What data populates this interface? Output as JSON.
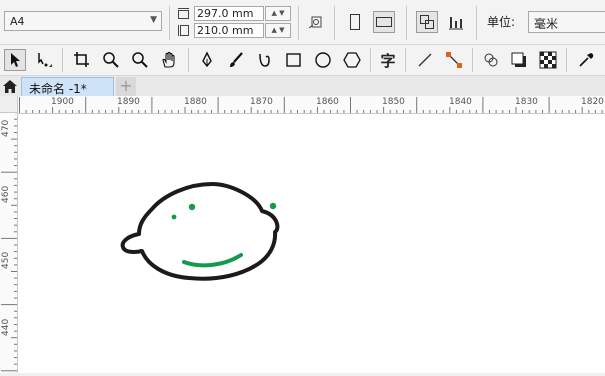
{
  "property_bar": {
    "page_size": "A4",
    "width_value": "297.0 mm",
    "height_value": "210.0 mm",
    "unit_label": "单位:",
    "unit_value": "毫米"
  },
  "tabs": {
    "document_title": "未命名 -1*",
    "add_tab": "+"
  },
  "ruler": {
    "horizontal_labels": [
      "1900",
      "1890",
      "1880",
      "1870",
      "1860",
      "1850",
      "1840",
      "1830",
      "1820"
    ],
    "vertical_labels": [
      "470",
      "460",
      "450",
      "440"
    ]
  },
  "toolbox": {
    "text_tool": "字"
  },
  "colors": {
    "accent_green": "#139a4a",
    "outline": "#1e1a1a",
    "tab_active": "#cfe3f8"
  }
}
